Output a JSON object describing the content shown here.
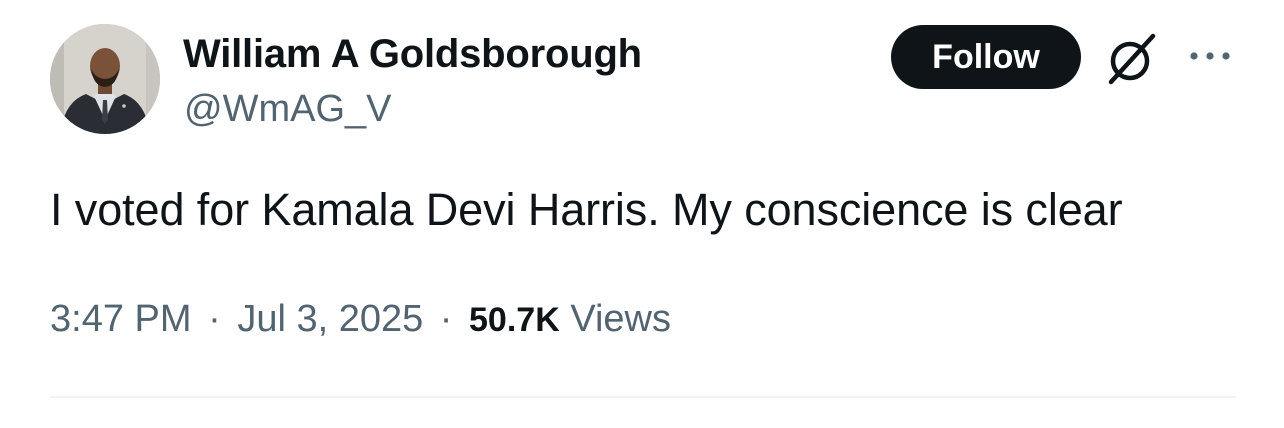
{
  "user": {
    "display_name": "William A Goldsborough",
    "handle": "@WmAG_V",
    "avatar_icon": "profile-photo"
  },
  "actions": {
    "follow_label": "Follow",
    "grok_icon": "grok-icon",
    "more_icon": "more-icon"
  },
  "tweet": {
    "text": "I voted for Kamala Devi Harris. My conscience is clear"
  },
  "meta": {
    "time": "3:47 PM",
    "separator1": "·",
    "date": "Jul 3, 2025",
    "separator2": "·",
    "views_count": "50.7K",
    "views_label": "Views"
  },
  "colors": {
    "text_primary": "#0f1419",
    "text_secondary": "#536471",
    "follow_bg": "#0f1419",
    "divider": "#eff3f4"
  }
}
